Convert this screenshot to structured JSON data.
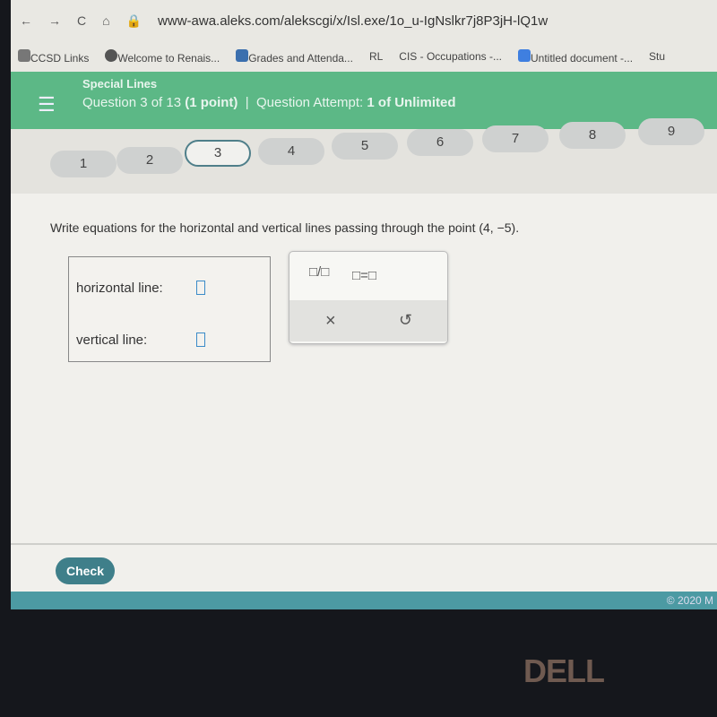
{
  "browser": {
    "url": "www-awa.aleks.com/alekscgi/x/Isl.exe/1o_u-IgNslkr7j8P3jH-lQ1w",
    "tabs": [
      "Untitled document -...",
      "Stu"
    ],
    "bookmarks": [
      "CCSD Links",
      "Welcome to Renais...",
      "Grades and Attenda...",
      "RL",
      "CIS - Occupations -..."
    ]
  },
  "header": {
    "topic": "Special Lines",
    "question": "Question 3 of 13",
    "points": "(1 point)",
    "attempt_label": "Question Attempt:",
    "attempt_value": "1 of Unlimited"
  },
  "question_nav": [
    "1",
    "2",
    "3",
    "4",
    "5",
    "6",
    "7",
    "8",
    "9"
  ],
  "current_question": "3",
  "prompt": "Write equations for the horizontal and vertical lines passing through the point (4, −5).",
  "answers": {
    "horizontal_label": "horizontal line:",
    "vertical_label": "vertical line:"
  },
  "pad": {
    "fraction": "□/□",
    "equals": "□=□",
    "clear": "×",
    "undo": "↺"
  },
  "footer": {
    "check": "Check",
    "copyright": "© 2020 M"
  },
  "bezel": {
    "logo": "DELL"
  },
  "colors": {
    "header": "#5cb886",
    "accent": "#3f7f8a",
    "bar": "#4c9aa3"
  }
}
